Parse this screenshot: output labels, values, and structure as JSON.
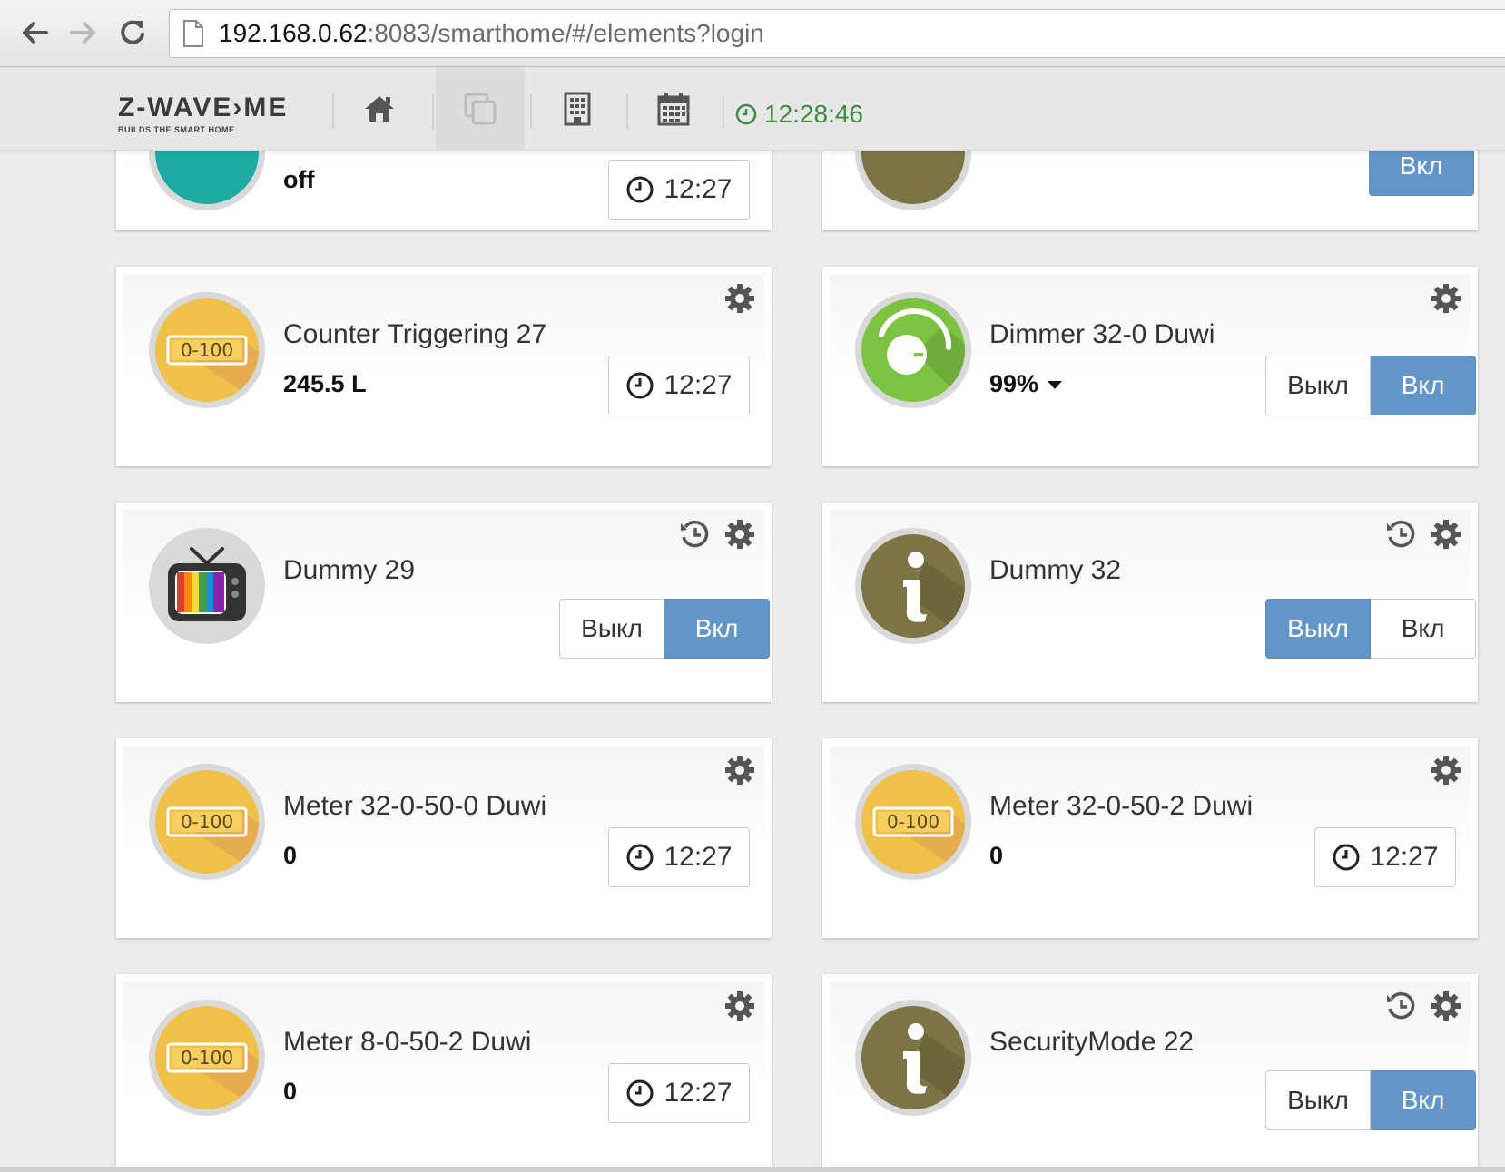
{
  "browser": {
    "url_host": "192.168.0.62",
    "url_path": ":8083/smarthome/#/elements?login"
  },
  "header": {
    "logo_main": "Z-WAVE›ME",
    "logo_sub": "BUILDS THE SMART HOME",
    "clock": "12:28:46"
  },
  "cards": {
    "partial_left": {
      "value": "off",
      "time": "12:27"
    },
    "partial_right": {
      "button": "Вкл"
    },
    "counter27": {
      "title": "Counter Triggering 27",
      "value": "245.5 L",
      "time": "12:27",
      "icon_text": "0-100"
    },
    "dimmer32": {
      "title": "Dimmer 32-0 Duwi",
      "value": "99%",
      "off": "Выкл",
      "on": "Вкл",
      "active": "on"
    },
    "dummy29": {
      "title": "Dummy 29",
      "off": "Выкл",
      "on": "Вкл",
      "active": "on"
    },
    "dummy32": {
      "title": "Dummy 32",
      "off": "Выкл",
      "on": "Вкл",
      "active": "off"
    },
    "meter32_0": {
      "title": "Meter 32-0-50-0 Duwi",
      "value": "0",
      "time": "12:27",
      "icon_text": "0-100"
    },
    "meter32_2": {
      "title": "Meter 32-0-50-2 Duwi",
      "value": "0",
      "time": "12:27",
      "icon_text": "0-100"
    },
    "meter8": {
      "title": "Meter 8-0-50-2 Duwi",
      "value": "0",
      "time": "12:27",
      "icon_text": "0-100"
    },
    "security22": {
      "title": "SecurityMode 22",
      "off": "Выкл",
      "on": "Вкл",
      "active": "on"
    }
  },
  "colors": {
    "accent_blue": "#6396c8",
    "clock_green": "#3f8b3f",
    "meter_yellow": "#f0c148",
    "dimmer_green": "#7cc243",
    "info_olive": "#7c7445"
  }
}
